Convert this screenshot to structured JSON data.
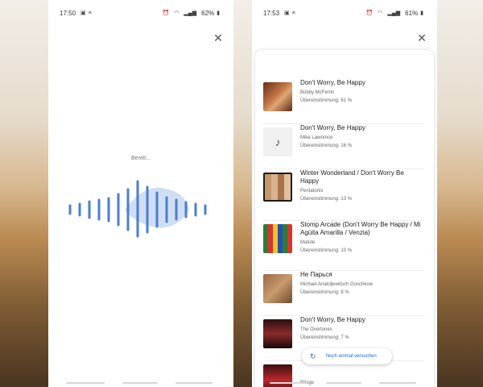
{
  "left_screen": {
    "status_time": "17:50",
    "battery": "62%",
    "listening_status": "Bereit..."
  },
  "right_screen": {
    "status_time": "17:53",
    "battery": "61%",
    "results": [
      {
        "title": "Don't Worry, Be Happy",
        "artist": "Bobby McFerrin",
        "match": "Übereinstimmung: 61 %",
        "icon": "album-art"
      },
      {
        "title": "Don't Worry, Be Happy",
        "artist": "Mike Lawrence",
        "match": "Übereinstimmung: 16 %",
        "icon": "music-note-icon"
      },
      {
        "title": "Winter Wonderland / Don't Worry Be Happy",
        "artist": "Pentatonix",
        "match": "Übereinstimmung: 13 %",
        "icon": "album-art"
      },
      {
        "title": "Stomp Arcade (Don't Worry Be Happy / Mi Agüita Amarilla / Venzia)",
        "artist": "Matute",
        "match": "Übereinstimmung: 10 %",
        "icon": "album-art"
      },
      {
        "title": "Не Парься",
        "artist": "Michael Anatoljewitsch Goschkow",
        "match": "Übereinstimmung: 8 %",
        "icon": "album-art"
      },
      {
        "title": "Don't Worry, Be Happy",
        "artist": "The Overtones",
        "match": "Übereinstimmung: 7 %",
        "icon": "album-art"
      },
      {
        "title": "",
        "artist": "Rilage",
        "match": "",
        "icon": "album-art"
      }
    ],
    "retry_label": "Noch einmal versuchen"
  },
  "colors": {
    "accent": "#1a66d2",
    "wave_bar": "#4a7fd0",
    "wave_fill": "#bcd0ee"
  }
}
